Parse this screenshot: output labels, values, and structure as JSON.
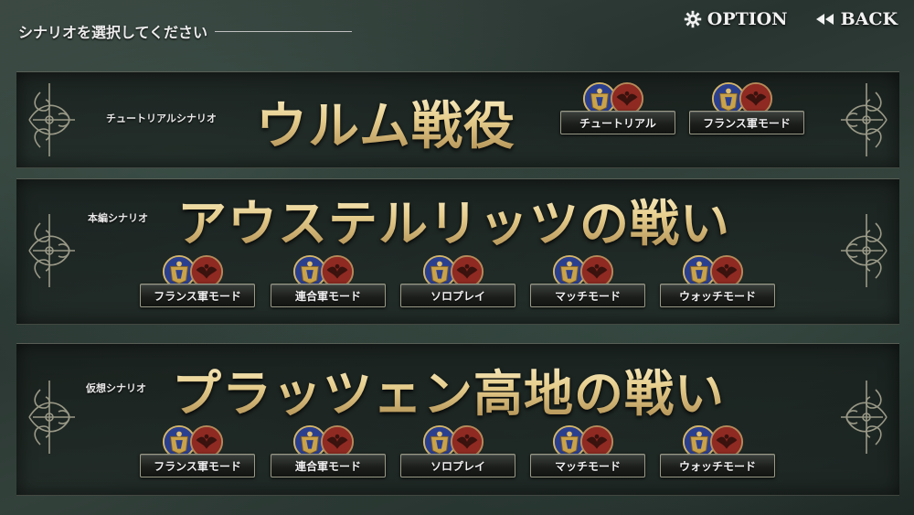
{
  "header": {
    "title": "シナリオを選択してください",
    "option_label": "OPTION",
    "back_label": "BACK"
  },
  "scenarios": [
    {
      "subtitle": "チュートリアルシナリオ",
      "title": "ウルム戦役",
      "modes": [
        {
          "label": "チュートリアル",
          "emblems": [
            "french-crest-icon",
            "allied-eagle-icon"
          ]
        },
        {
          "label": "フランス軍モード",
          "emblems": [
            "french-crest-icon",
            "allied-eagle-icon"
          ]
        }
      ]
    },
    {
      "subtitle": "本編シナリオ",
      "title": "アウステルリッツの戦い",
      "modes": [
        {
          "label": "フランス軍モード",
          "emblems": [
            "french-crest-icon",
            "allied-eagle-icon"
          ]
        },
        {
          "label": "連合軍モード",
          "emblems": [
            "french-crest-icon",
            "allied-eagle-icon"
          ]
        },
        {
          "label": "ソロプレイ",
          "emblems": [
            "french-crest-icon",
            "allied-eagle-icon"
          ]
        },
        {
          "label": "マッチモード",
          "emblems": [
            "french-crest-icon",
            "allied-eagle-icon"
          ]
        },
        {
          "label": "ウォッチモード",
          "emblems": [
            "french-crest-icon",
            "allied-eagle-icon"
          ]
        }
      ]
    },
    {
      "subtitle": "仮想シナリオ",
      "title": "プラッツェン高地の戦い",
      "modes": [
        {
          "label": "フランス軍モード",
          "emblems": [
            "french-crest-icon",
            "allied-eagle-icon"
          ]
        },
        {
          "label": "連合軍モード",
          "emblems": [
            "french-crest-icon",
            "allied-eagle-icon"
          ]
        },
        {
          "label": "ソロプレイ",
          "emblems": [
            "french-crest-icon",
            "allied-eagle-icon"
          ]
        },
        {
          "label": "マッチモード",
          "emblems": [
            "french-crest-icon",
            "allied-eagle-icon"
          ]
        },
        {
          "label": "ウォッチモード",
          "emblems": [
            "french-crest-icon",
            "allied-eagle-icon"
          ]
        }
      ]
    }
  ],
  "colors": {
    "gold_title": "#e7cf8f",
    "french_blue": "#2b3f8f",
    "allied_red": "#8e2a22"
  }
}
